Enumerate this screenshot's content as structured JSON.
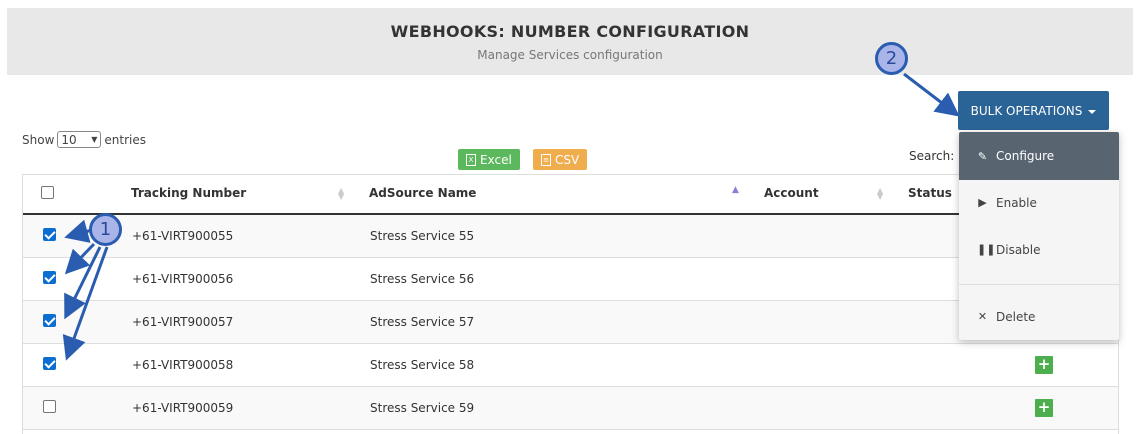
{
  "header": {
    "title": "WEBHOOKS: NUMBER CONFIGURATION",
    "subtitle": "Manage Services configuration"
  },
  "length_menu": {
    "show_label": "Show",
    "selected": "10",
    "entries_label": "entries"
  },
  "export": {
    "excel_label": "Excel",
    "csv_label": "CSV"
  },
  "search": {
    "label": "Search:"
  },
  "bulk": {
    "button_label": "BULK OPERATIONS",
    "menu": [
      {
        "label": "Configure",
        "icon": "edit-icon"
      },
      {
        "label": "Enable",
        "icon": "play-icon"
      },
      {
        "label": "Disable",
        "icon": "pause-icon"
      },
      {
        "label": "Delete",
        "icon": "close-icon"
      }
    ]
  },
  "table": {
    "columns": [
      "Tracking Number",
      "AdSource Name",
      "Account",
      "Status"
    ],
    "rows": [
      {
        "checked": true,
        "tracking": "+61-VIRT900055",
        "adsource": "Stress Service 55"
      },
      {
        "checked": true,
        "tracking": "+61-VIRT900056",
        "adsource": "Stress Service 56"
      },
      {
        "checked": true,
        "tracking": "+61-VIRT900057",
        "adsource": "Stress Service 57"
      },
      {
        "checked": true,
        "tracking": "+61-VIRT900058",
        "adsource": "Stress Service 58"
      },
      {
        "checked": false,
        "tracking": "+61-VIRT900059",
        "adsource": "Stress Service 59"
      }
    ]
  },
  "callouts": {
    "one": "1",
    "two": "2"
  },
  "colors": {
    "bulk_button": "#2a6496",
    "excel": "#5cb85c",
    "csv": "#f0ad4e",
    "callout_fill": "#a9b4e8",
    "callout_stroke": "#2a5db0",
    "plus": "#4cae4c"
  }
}
